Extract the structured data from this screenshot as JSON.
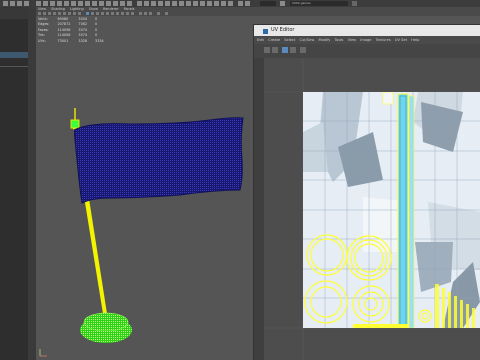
{
  "app": {
    "camera_select_value": "2000 games",
    "frame_field": ""
  },
  "viewport": {
    "menu": [
      "View",
      "Shading",
      "Lighting",
      "Show",
      "Renderer",
      "Panels"
    ],
    "hud": {
      "rows": [
        [
          "Verts:",
          "69080",
          "3504",
          "0"
        ],
        [
          "Edges:",
          "207872",
          "7062",
          "0"
        ],
        [
          "Faces:",
          "114098",
          "3574",
          "0"
        ],
        [
          "Tris:",
          "114008",
          "3574",
          "0"
        ],
        [
          "UVs:",
          "73001",
          "3328",
          "3334"
        ]
      ]
    }
  },
  "uv_editor": {
    "title": "UV Editor",
    "menu": [
      "Edit",
      "Create",
      "Select",
      "Cut/Sew",
      "Modify",
      "Tools",
      "View",
      "Image",
      "Textures",
      "UV Set",
      "Help"
    ]
  },
  "colors": {
    "flag": "#1a1a7a",
    "pole": "#f3f300",
    "base": "#44ee22",
    "uv_wire": "#ffff33",
    "uv_tile_highlight": "#6fd4ee"
  }
}
